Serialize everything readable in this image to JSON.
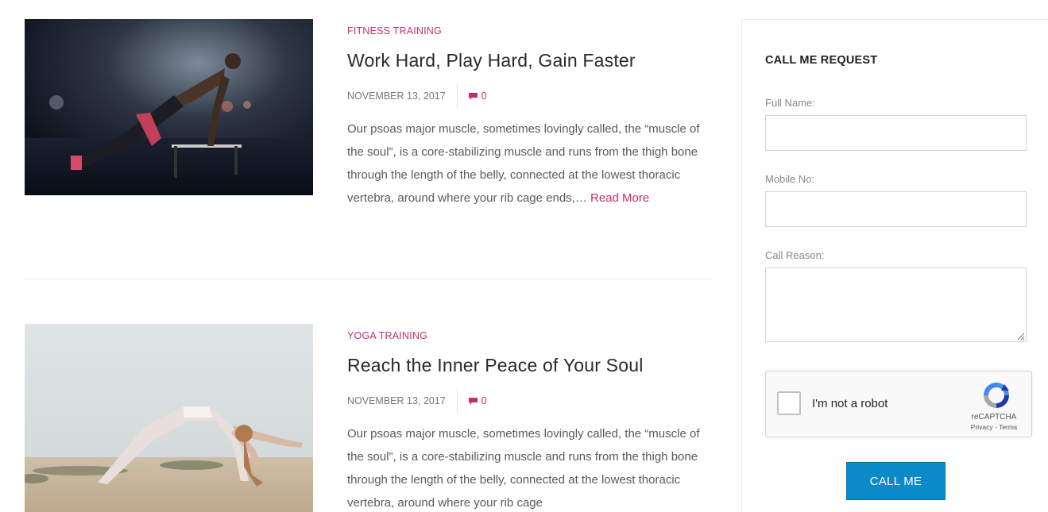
{
  "posts": [
    {
      "category": "Fitness Training",
      "title": "Work Hard, Play Hard, Gain Faster",
      "date": "NOVEMBER 13, 2017",
      "comments": "0",
      "excerpt": "Our psoas major muscle, sometimes lovingly called, the “muscle of the soul”, is a core-stabilizing muscle and runs from the thigh bone through the length of the belly, connected at the lowest thoracic vertebra, around where your rib cage ends,…",
      "read_more": "Read More"
    },
    {
      "category": "Yoga Training",
      "title": "Reach the Inner Peace of Your Soul",
      "date": "NOVEMBER 13, 2017",
      "comments": "0",
      "excerpt": "Our psoas major muscle, sometimes lovingly called, the “muscle of the soul”, is a core-stabilizing muscle and runs from the thigh bone through the length of the belly, connected at the lowest thoracic vertebra, around where your rib cage"
    }
  ],
  "sidebar": {
    "title": "CALL ME REQUEST",
    "full_name_label": "Full Name:",
    "full_name_value": "",
    "mobile_label": "Mobile No:",
    "mobile_value": "",
    "reason_label": "Call Reason:",
    "reason_value": "",
    "recaptcha": {
      "label": "I'm not a robot",
      "brand": "reCAPTCHA",
      "links": "Privacy - Terms"
    },
    "button_label": "CALL ME"
  },
  "colors": {
    "accent": "#c0306e",
    "button": "#0b8ac8"
  },
  "icons": {
    "comment": "comment-icon",
    "recaptcha": "recaptcha-logo-icon"
  }
}
